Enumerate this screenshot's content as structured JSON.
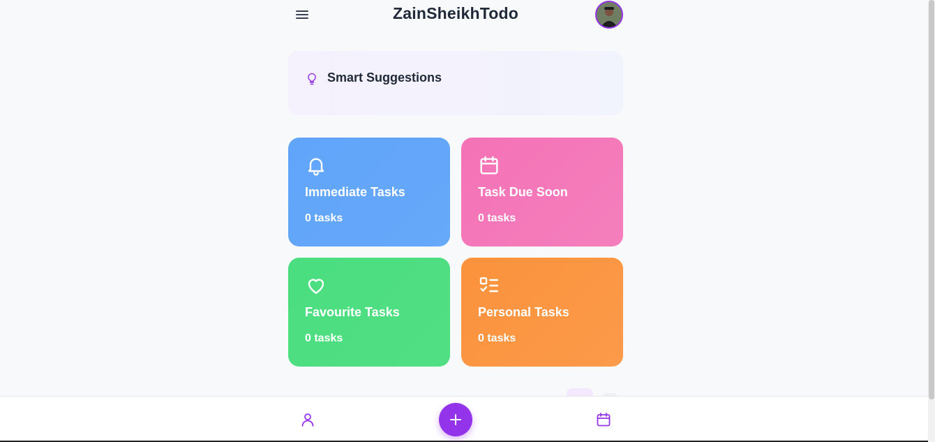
{
  "app": {
    "title": "ZainSheikhTodo"
  },
  "suggestions": {
    "label": "Smart Suggestions"
  },
  "cards": [
    {
      "title": "Immediate Tasks",
      "count": "0 tasks",
      "icon": "bell-icon",
      "color": "#60a5fa"
    },
    {
      "title": "Task Due Soon",
      "count": "0 tasks",
      "icon": "calendar-icon",
      "color": "#f472b6"
    },
    {
      "title": "Favourite Tasks",
      "count": "0 tasks",
      "icon": "heart-icon",
      "color": "#4ade80"
    },
    {
      "title": "Personal Tasks",
      "count": "0 tasks",
      "icon": "list-checks-icon",
      "color": "#fb923c"
    }
  ],
  "bottom_nav": {
    "left_icon": "user-icon",
    "center_icon": "plus-icon",
    "right_icon": "calendar-icon"
  },
  "colors": {
    "accent": "#9333ea"
  }
}
